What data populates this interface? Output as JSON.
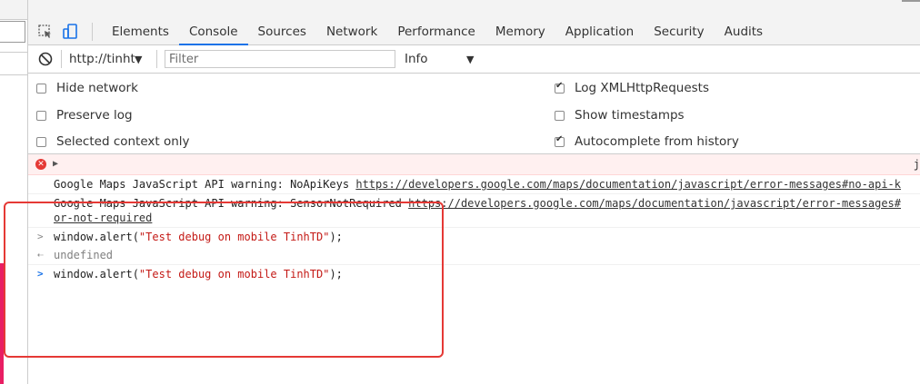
{
  "devtools": {
    "tabs": [
      {
        "label": "Elements"
      },
      {
        "label": "Console"
      },
      {
        "label": "Sources"
      },
      {
        "label": "Network"
      },
      {
        "label": "Performance"
      },
      {
        "label": "Memory"
      },
      {
        "label": "Application"
      },
      {
        "label": "Security"
      },
      {
        "label": "Audits"
      }
    ],
    "active_tab": "Console"
  },
  "console_toolbar": {
    "context": "http://tinhtc",
    "filter_placeholder": "Filter",
    "level": "Info"
  },
  "settings": {
    "hide_network": {
      "label": "Hide network",
      "checked": false
    },
    "preserve_log": {
      "label": "Preserve log",
      "checked": false
    },
    "selected_context_only": {
      "label": "Selected context only",
      "checked": false
    },
    "log_xhr": {
      "label": "Log XMLHttpRequests",
      "checked": true
    },
    "show_timestamps": {
      "label": "Show timestamps",
      "checked": false
    },
    "autocomplete_history": {
      "label": "Autocomplete from history",
      "checked": true
    }
  },
  "messages": {
    "error_source": "j",
    "warn1_text": "Google Maps JavaScript API warning: NoApiKeys ",
    "warn1_link": "https://developers.google.com/maps/documentation/javascript/error-messages#no-api-k",
    "warn2_text": "Google Maps JavaScript API warning: SensorNotRequired ",
    "warn2_link": "https://developers.google.com/maps/documentation/javascript/error-messages#",
    "warn2_link_cont": "or-not-required",
    "cmd1_prefix": "window.alert(",
    "cmd1_string": "\"Test debug on mobile TinhTD\"",
    "cmd1_suffix": ");",
    "result1": "undefined",
    "cmd2_prefix": "window.alert(",
    "cmd2_string": "\"Test debug on mobile TinhTD\"",
    "cmd2_suffix": ");"
  },
  "colors": {
    "accent": "#1a73e8",
    "error": "#e53935",
    "string": "#c41a16",
    "annotation": "#e53935"
  }
}
